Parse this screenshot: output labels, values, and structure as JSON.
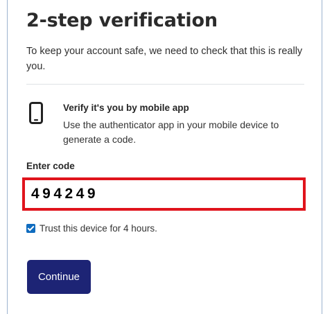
{
  "header": {
    "title": "2-step verification",
    "intro": "To keep your account safe, we need to check that this is really you."
  },
  "method": {
    "icon": "mobile-phone-icon",
    "title": "Verify it's you by mobile app",
    "description": "Use the authenticator app in your mobile device to generate a code."
  },
  "code": {
    "label": "Enter code",
    "value": "494249"
  },
  "trust": {
    "checked": true,
    "label": "Trust this device for 4 hours."
  },
  "actions": {
    "continue_label": "Continue"
  },
  "colors": {
    "highlight_border": "#e0141c",
    "button_background": "#1d2475",
    "checkbox": "#0f6cbf"
  }
}
